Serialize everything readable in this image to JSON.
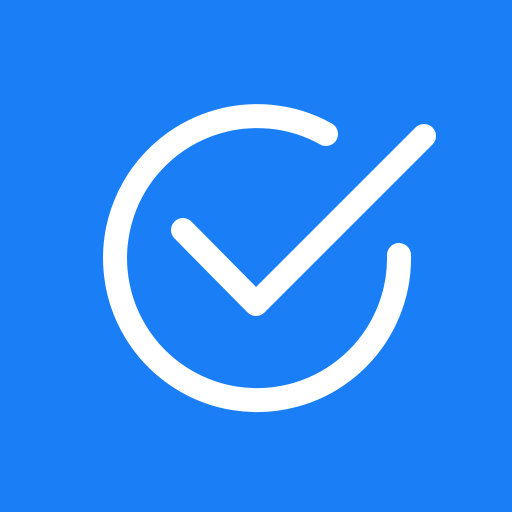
{
  "icon": {
    "name": "check-circle-icon",
    "background_color": "#1a7ef7",
    "stroke_color": "#ffffff"
  }
}
